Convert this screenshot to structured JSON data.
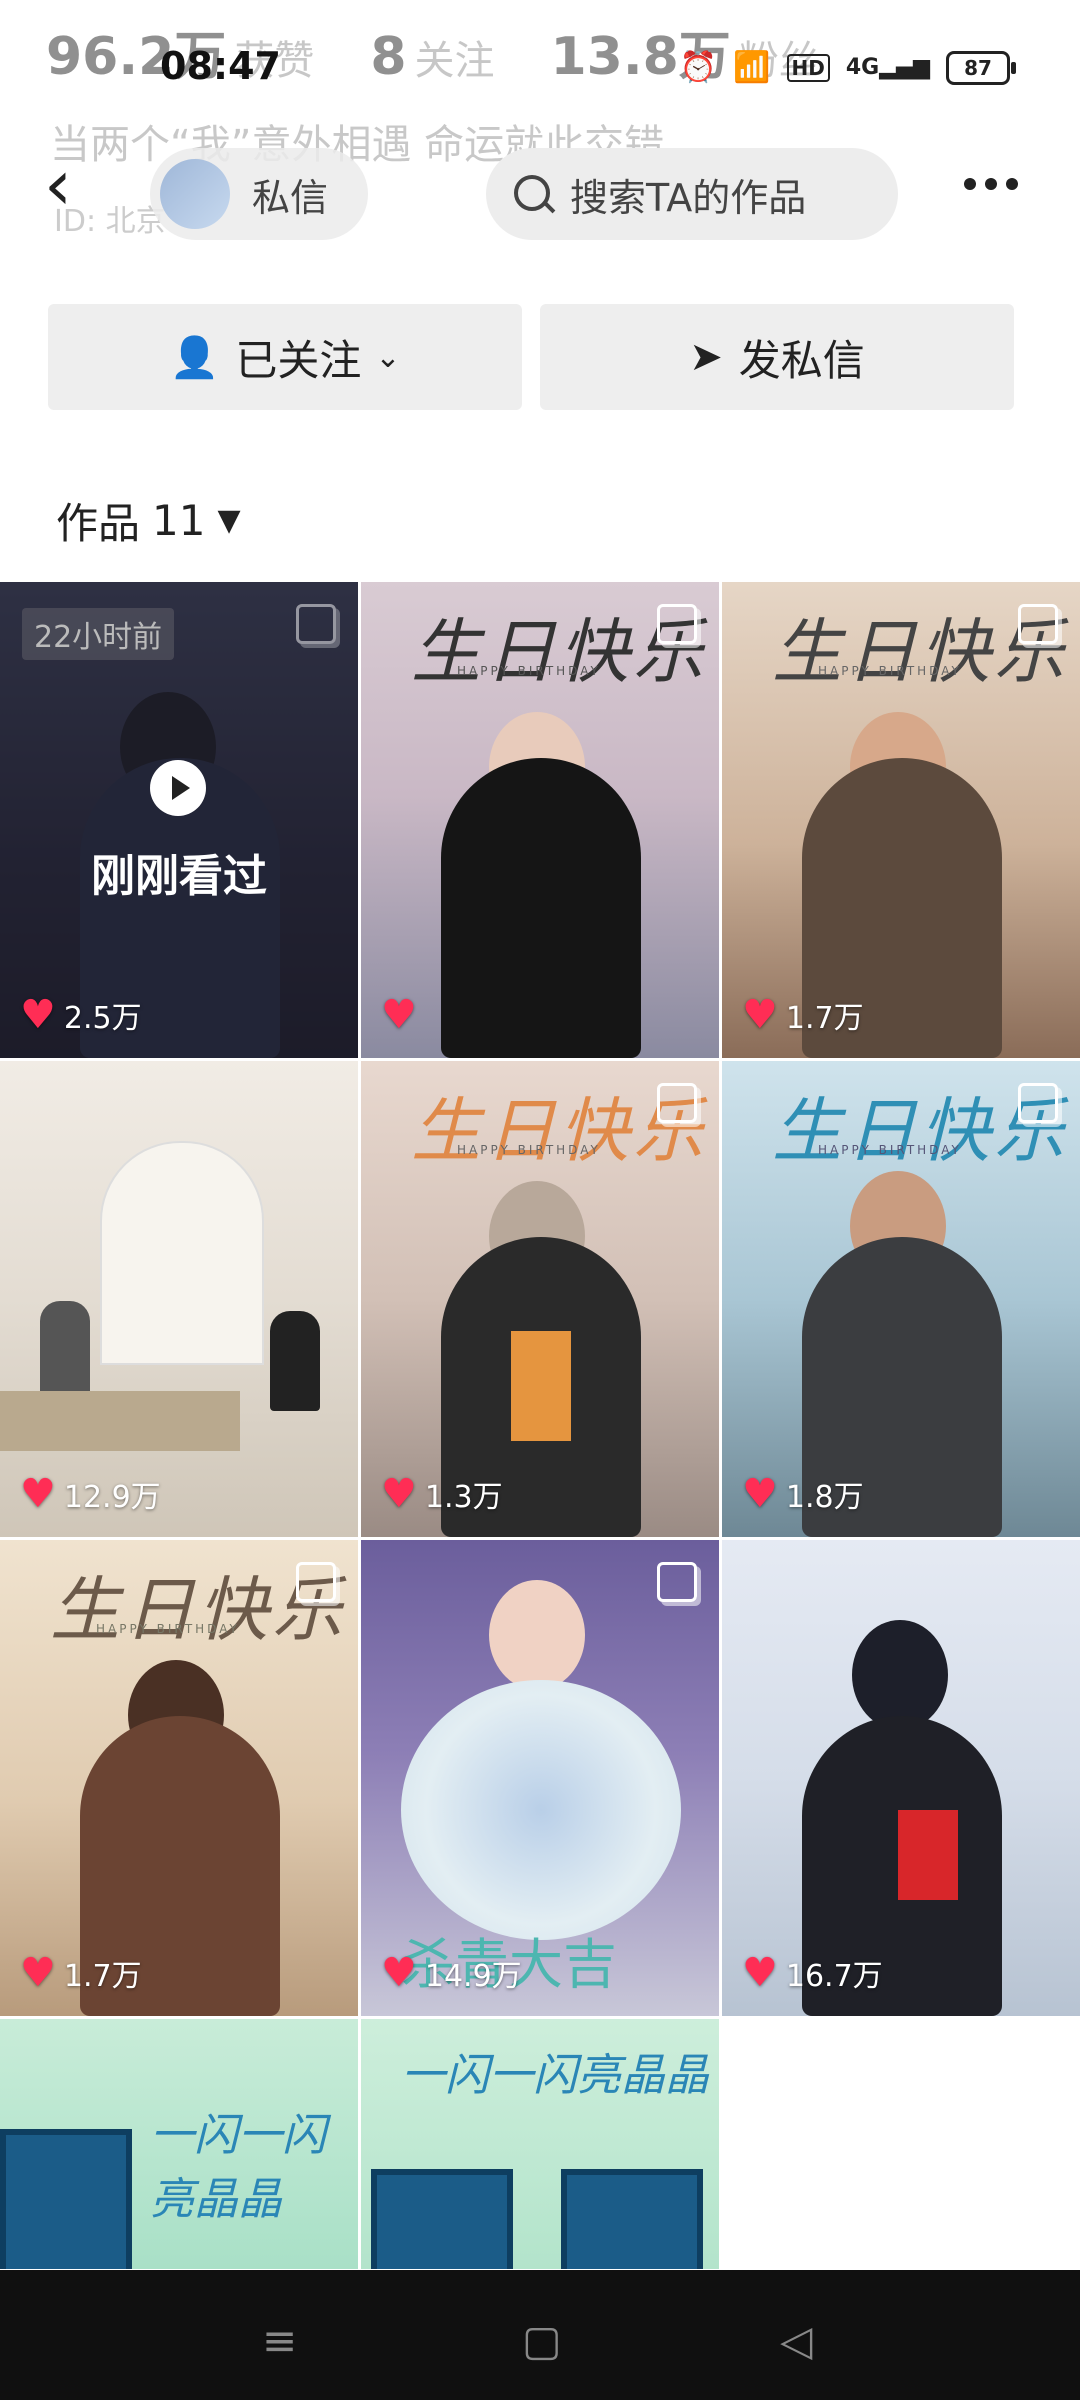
{
  "status": {
    "time": "08:47",
    "battery": "87",
    "network": "4G",
    "hd": "HD"
  },
  "profile_bg": {
    "likes_num": "96.2万",
    "likes_lbl": "获赞",
    "following_num": "8",
    "following_lbl": "关注",
    "fans_num": "13.8万",
    "fans_lbl": "粉丝",
    "bio": "当两个“我”意外相遇 命运就此交错",
    "id_line": "ID: 北京"
  },
  "topbar": {
    "dm_label": "私信",
    "search_placeholder": "搜索TA的作品"
  },
  "actions": {
    "follow_label": "已关注",
    "message_label": "发私信"
  },
  "works": {
    "label": "作品",
    "count": "11"
  },
  "poster_text": {
    "title": "生日快乐",
    "subtitle": "HAPPY BIRTHDAY",
    "wrap": "一闪一闪亮晶晶",
    "slogan": "杀青大吉"
  },
  "tiles": [
    {
      "likes": "2.5万",
      "time_badge": "22小时前",
      "recent_label": "刚刚看过"
    },
    {
      "likes": ""
    },
    {
      "likes": "1.7万"
    },
    {
      "likes": "12.9万"
    },
    {
      "likes": "1.3万"
    },
    {
      "likes": "1.8万"
    },
    {
      "likes": "1.7万"
    },
    {
      "likes": "14.9万"
    },
    {
      "likes": "16.7万"
    },
    {
      "likes": ""
    },
    {
      "likes": ""
    }
  ],
  "colors": {
    "like_heart": "#ff2d55",
    "nav_bg": "#101010"
  }
}
